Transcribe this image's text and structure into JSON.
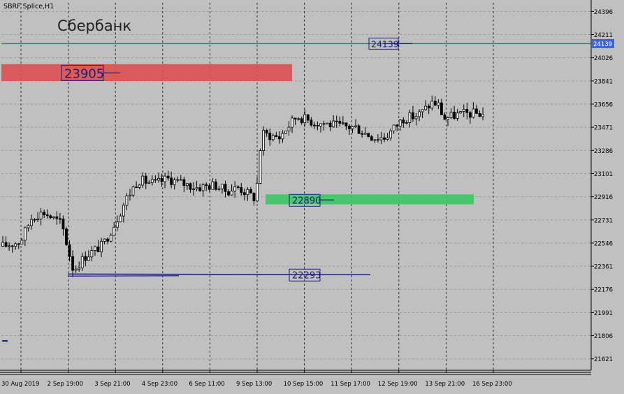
{
  "window": {
    "title": "SBRF Splice,H1"
  },
  "colors": {
    "background": "#c0c0c0",
    "grid": "#9a9a9a",
    "candle_up": "#ffffff",
    "candle_down": "#000000",
    "resistance_zone": "#dc5050",
    "support_zone": "#3cc864",
    "level_line": "#3c64dc",
    "trend_line": "#1e1e78",
    "price_tag_bg": "#3c64dc"
  },
  "chart_data": {
    "type": "candlestick",
    "title": "Сбербанк",
    "symbol": "SBRF Splice",
    "timeframe": "H1",
    "ylim": [
      21530,
      24465
    ],
    "y_ticks": [
      "24396",
      "24211",
      "24026",
      "23841",
      "23656",
      "23471",
      "23286",
      "23101",
      "22916",
      "22731",
      "22546",
      "22361",
      "22176",
      "21991",
      "21806",
      "21621"
    ],
    "x_ticks": [
      "30 Aug 2019",
      "2 Sep 19:00",
      "3 Sep 21:00",
      "4 Sep 23:00",
      "6 Sep 11:00",
      "9 Sep 13:00",
      "10 Sep 15:00",
      "11 Sep 17:00",
      "12 Sep 19:00",
      "13 Sep 21:00",
      "16 Sep 23:00"
    ],
    "current_price": "24139",
    "levels": [
      {
        "label": "24139",
        "price": 24139,
        "kind": "horizontal-line"
      },
      {
        "label": "23905",
        "price": 23905,
        "kind": "resistance-zone",
        "low": 23840,
        "high": 23975
      },
      {
        "label": "22890",
        "price": 22890,
        "kind": "support-zone",
        "low": 22855,
        "high": 22935
      },
      {
        "label": "22293",
        "price": 22293,
        "kind": "trend-line"
      }
    ],
    "close_path": [
      [
        0,
        22520
      ],
      [
        0.03,
        22560
      ],
      [
        0.05,
        22760
      ],
      [
        0.07,
        22790
      ],
      [
        0.1,
        22700
      ],
      [
        0.12,
        22330
      ],
      [
        0.14,
        22440
      ],
      [
        0.17,
        22530
      ],
      [
        0.19,
        22700
      ],
      [
        0.21,
        22900
      ],
      [
        0.23,
        23050
      ],
      [
        0.26,
        23020
      ],
      [
        0.28,
        23060
      ],
      [
        0.3,
        23030
      ],
      [
        0.33,
        22990
      ],
      [
        0.36,
        23010
      ],
      [
        0.38,
        22960
      ],
      [
        0.4,
        22990
      ],
      [
        0.42,
        22930
      ],
      [
        0.43,
        22900
      ],
      [
        0.44,
        23420
      ],
      [
        0.47,
        23390
      ],
      [
        0.48,
        23450
      ],
      [
        0.5,
        23560
      ],
      [
        0.53,
        23510
      ],
      [
        0.55,
        23500
      ],
      [
        0.57,
        23480
      ],
      [
        0.6,
        23470
      ],
      [
        0.61,
        23440
      ],
      [
        0.63,
        23390
      ],
      [
        0.65,
        23390
      ],
      [
        0.66,
        23440
      ],
      [
        0.68,
        23540
      ],
      [
        0.7,
        23560
      ],
      [
        0.71,
        23580
      ],
      [
        0.73,
        23670
      ],
      [
        0.74,
        23650
      ],
      [
        0.75,
        23540
      ],
      [
        0.77,
        23570
      ],
      [
        0.79,
        23580
      ]
    ]
  }
}
